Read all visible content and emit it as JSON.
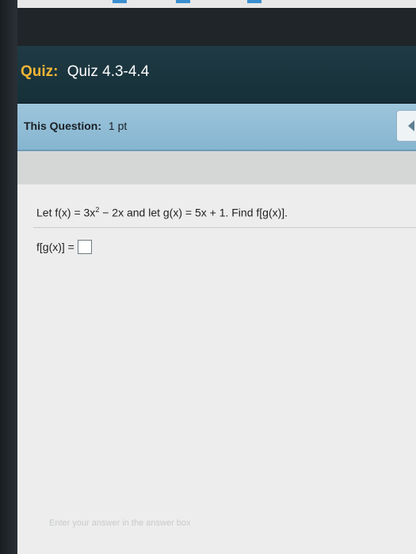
{
  "quiz": {
    "label": "Quiz:",
    "name": "Quiz 4.3-4.4"
  },
  "question_bar": {
    "label": "This Question:",
    "points": "1 pt"
  },
  "problem": {
    "text_before_sup": "Let f(x) = 3x",
    "sup": "2",
    "text_after_sup": " − 2x and let g(x) = 5x + 1. Find f[g(x)]."
  },
  "answer": {
    "label": "f[g(x)] =",
    "value": ""
  },
  "hint": "Enter your answer in the answer box"
}
